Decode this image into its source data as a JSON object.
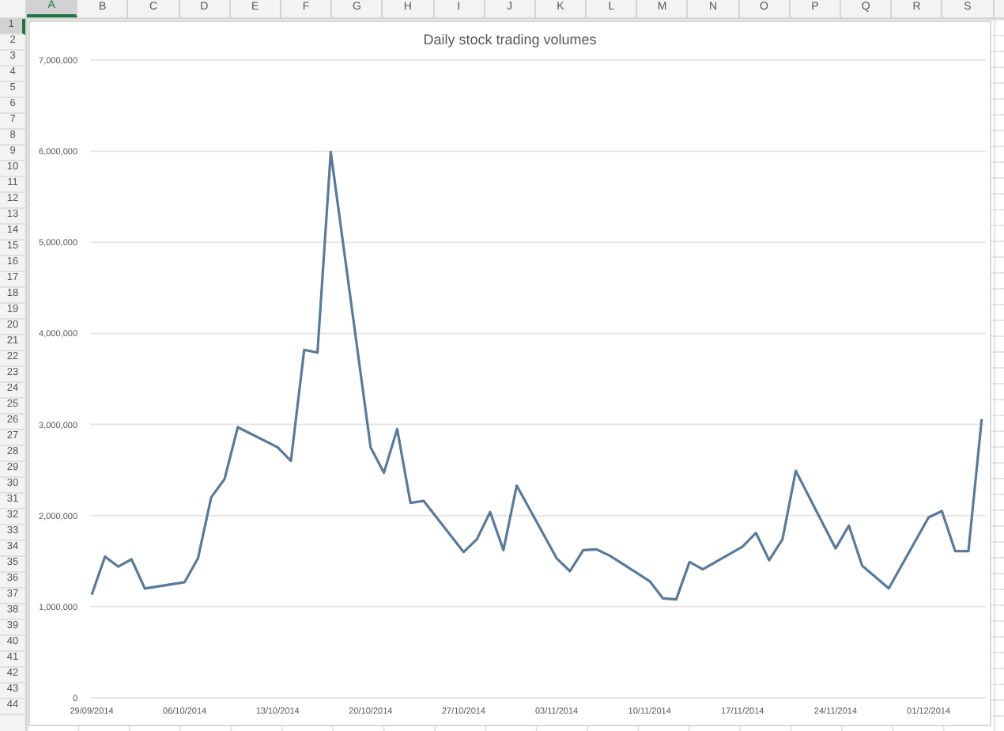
{
  "sheet": {
    "columns": [
      {
        "label": "A",
        "selected": true
      },
      {
        "label": "B",
        "selected": false
      },
      {
        "label": "C",
        "selected": false
      },
      {
        "label": "D",
        "selected": false
      },
      {
        "label": "E",
        "selected": false
      },
      {
        "label": "F",
        "selected": false
      },
      {
        "label": "G",
        "selected": false
      },
      {
        "label": "H",
        "selected": false
      },
      {
        "label": "I",
        "selected": false
      },
      {
        "label": "J",
        "selected": false
      },
      {
        "label": "K",
        "selected": false
      },
      {
        "label": "L",
        "selected": false
      },
      {
        "label": "M",
        "selected": false
      },
      {
        "label": "N",
        "selected": false
      },
      {
        "label": "O",
        "selected": false
      },
      {
        "label": "P",
        "selected": false
      },
      {
        "label": "Q",
        "selected": false
      },
      {
        "label": "R",
        "selected": false
      },
      {
        "label": "S",
        "selected": false
      }
    ],
    "rows": [
      {
        "label": "1",
        "selected": true
      },
      {
        "label": "2",
        "selected": false
      },
      {
        "label": "3",
        "selected": false
      },
      {
        "label": "4",
        "selected": false
      },
      {
        "label": "5",
        "selected": false
      },
      {
        "label": "6",
        "selected": false
      },
      {
        "label": "7",
        "selected": false
      },
      {
        "label": "8",
        "selected": false
      },
      {
        "label": "9",
        "selected": false
      },
      {
        "label": "10",
        "selected": false
      },
      {
        "label": "11",
        "selected": false
      },
      {
        "label": "12",
        "selected": false
      },
      {
        "label": "13",
        "selected": false
      },
      {
        "label": "14",
        "selected": false
      },
      {
        "label": "15",
        "selected": false
      },
      {
        "label": "16",
        "selected": false
      },
      {
        "label": "17",
        "selected": false
      },
      {
        "label": "18",
        "selected": false
      },
      {
        "label": "19",
        "selected": false
      },
      {
        "label": "20",
        "selected": false
      },
      {
        "label": "21",
        "selected": false
      },
      {
        "label": "22",
        "selected": false
      },
      {
        "label": "23",
        "selected": false
      },
      {
        "label": "24",
        "selected": false
      },
      {
        "label": "25",
        "selected": false
      },
      {
        "label": "26",
        "selected": false
      },
      {
        "label": "27",
        "selected": false
      },
      {
        "label": "28",
        "selected": false
      },
      {
        "label": "29",
        "selected": false
      },
      {
        "label": "30",
        "selected": false
      },
      {
        "label": "31",
        "selected": false
      },
      {
        "label": "32",
        "selected": false
      },
      {
        "label": "33",
        "selected": false
      },
      {
        "label": "34",
        "selected": false
      },
      {
        "label": "35",
        "selected": false
      },
      {
        "label": "36",
        "selected": false
      },
      {
        "label": "37",
        "selected": false
      },
      {
        "label": "38",
        "selected": false
      },
      {
        "label": "39",
        "selected": false
      },
      {
        "label": "40",
        "selected": false
      },
      {
        "label": "41",
        "selected": false
      },
      {
        "label": "42",
        "selected": false
      },
      {
        "label": "43",
        "selected": false
      },
      {
        "label": "44",
        "selected": false
      }
    ]
  },
  "chart": {
    "chart_data": {
      "type": "line",
      "title": "Daily stock trading volumes",
      "grid": true,
      "categories": [
        "29/09/2014",
        null,
        null,
        null,
        null,
        null,
        null,
        "06/10/2014",
        null,
        null,
        null,
        null,
        null,
        null,
        "13/10/2014",
        null,
        null,
        null,
        null,
        null,
        null,
        "20/10/2014",
        null,
        null,
        null,
        null,
        null,
        null,
        "27/10/2014",
        null,
        null,
        null,
        null,
        null,
        null,
        "03/11/2014",
        null,
        null,
        null,
        null,
        null,
        null,
        "10/11/2014",
        null,
        null,
        null,
        null,
        null,
        null,
        "17/11/2014",
        null,
        null,
        null,
        null,
        null,
        null,
        "24/11/2014",
        null,
        null,
        null,
        null,
        null,
        null,
        "01/12/2014",
        null,
        null,
        null,
        null
      ],
      "series": [
        {
          "color": "#5a7a99",
          "values": [
            1130000,
            1550000,
            1440000,
            1520000,
            1200000,
            null,
            null,
            1270000,
            1530000,
            2200000,
            2400000,
            2970000,
            null,
            null,
            2750000,
            2600000,
            3820000,
            3790000,
            5990000,
            null,
            null,
            2750000,
            2470000,
            2950000,
            2140000,
            2160000,
            null,
            null,
            1600000,
            1740000,
            2040000,
            1620000,
            2330000,
            null,
            null,
            1530000,
            1390000,
            1620000,
            1630000,
            1560000,
            null,
            null,
            1280000,
            1090000,
            1080000,
            1490000,
            1410000,
            null,
            null,
            1660000,
            1810000,
            1510000,
            1740000,
            2490000,
            null,
            null,
            1640000,
            1890000,
            1450000,
            null,
            1200000,
            null,
            null,
            1980000,
            2050000,
            1610000,
            1610000,
            3060000
          ]
        }
      ],
      "ylim": [
        0,
        7000000
      ],
      "yticks": [
        {
          "value": 0,
          "label": "0"
        },
        {
          "value": 1000000,
          "label": "1,000,000"
        },
        {
          "value": 2000000,
          "label": "2,000,000"
        },
        {
          "value": 3000000,
          "label": "3,000,000"
        },
        {
          "value": 4000000,
          "label": "4,000,000"
        },
        {
          "value": 5000000,
          "label": "5,000,000"
        },
        {
          "value": 6000000,
          "label": "6,000,000"
        },
        {
          "value": 7000000,
          "label": "7,000,000"
        }
      ]
    }
  }
}
